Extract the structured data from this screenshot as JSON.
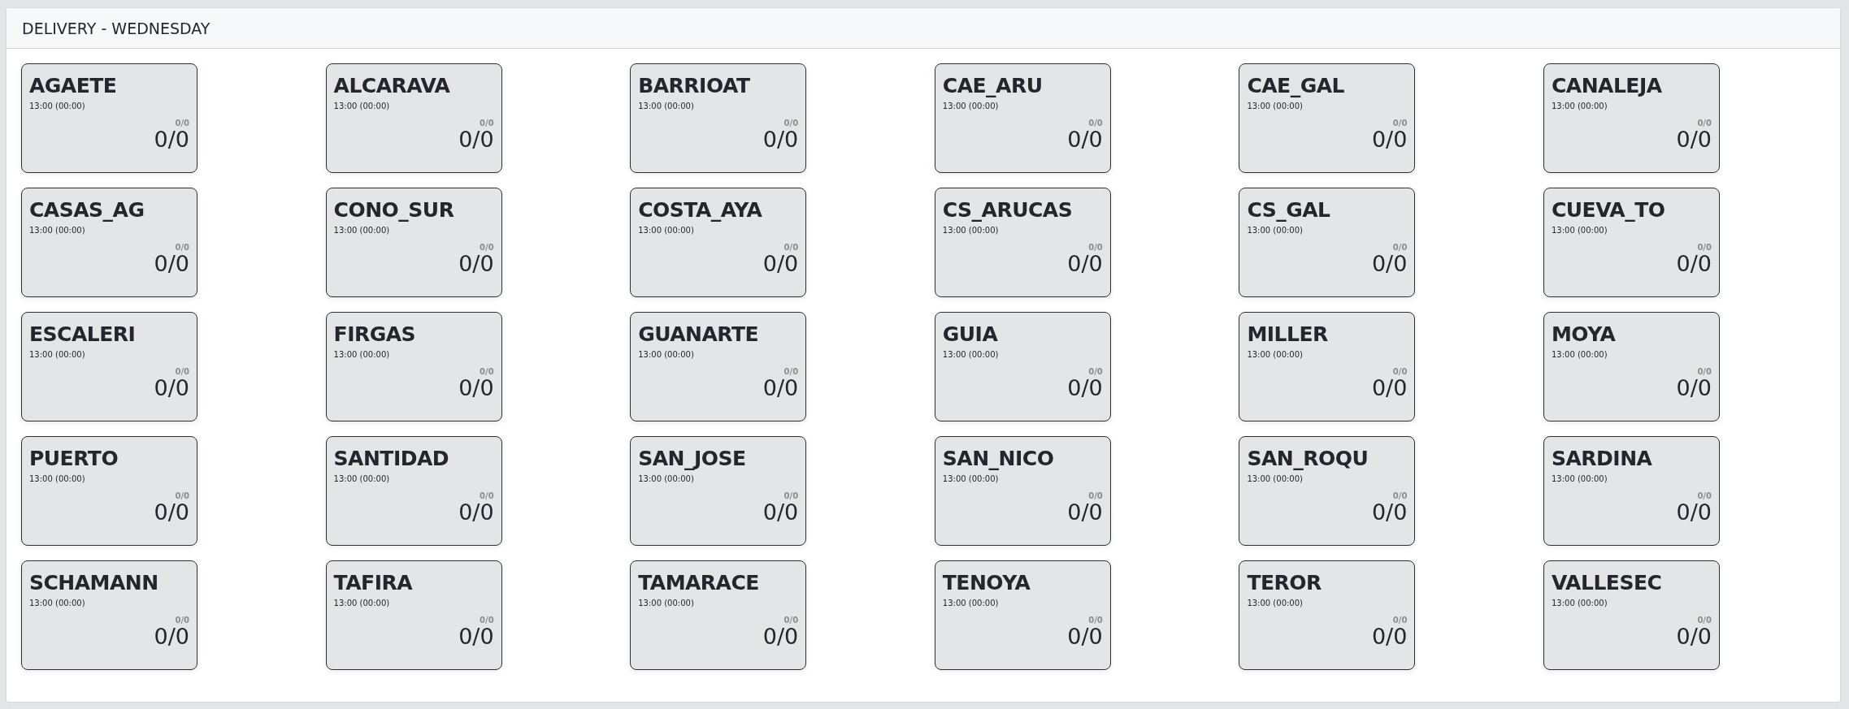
{
  "panel": {
    "title": "DELIVERY - WEDNESDAY"
  },
  "cards": [
    {
      "name": "AGAETE",
      "time": "13:00 (00:00)",
      "small_count": "0/0",
      "count": "0/0"
    },
    {
      "name": "ALCARAVA",
      "time": "13:00 (00:00)",
      "small_count": "0/0",
      "count": "0/0"
    },
    {
      "name": "BARRIOAT",
      "time": "13:00 (00:00)",
      "small_count": "0/0",
      "count": "0/0"
    },
    {
      "name": "CAE_ARU",
      "time": "13:00 (00:00)",
      "small_count": "0/0",
      "count": "0/0"
    },
    {
      "name": "CAE_GAL",
      "time": "13:00 (00:00)",
      "small_count": "0/0",
      "count": "0/0"
    },
    {
      "name": "CANALEJA",
      "time": "13:00 (00:00)",
      "small_count": "0/0",
      "count": "0/0"
    },
    {
      "name": "CASAS_AG",
      "time": "13:00 (00:00)",
      "small_count": "0/0",
      "count": "0/0"
    },
    {
      "name": "CONO_SUR",
      "time": "13:00 (00:00)",
      "small_count": "0/0",
      "count": "0/0"
    },
    {
      "name": "COSTA_AYA",
      "time": "13:00 (00:00)",
      "small_count": "0/0",
      "count": "0/0"
    },
    {
      "name": "CS_ARUCAS",
      "time": "13:00 (00:00)",
      "small_count": "0/0",
      "count": "0/0"
    },
    {
      "name": "CS_GAL",
      "time": "13:00 (00:00)",
      "small_count": "0/0",
      "count": "0/0"
    },
    {
      "name": "CUEVA_TO",
      "time": "13:00 (00:00)",
      "small_count": "0/0",
      "count": "0/0"
    },
    {
      "name": "ESCALERI",
      "time": "13:00 (00:00)",
      "small_count": "0/0",
      "count": "0/0"
    },
    {
      "name": "FIRGAS",
      "time": "13:00 (00:00)",
      "small_count": "0/0",
      "count": "0/0"
    },
    {
      "name": "GUANARTE",
      "time": "13:00 (00:00)",
      "small_count": "0/0",
      "count": "0/0"
    },
    {
      "name": "GUIA",
      "time": "13:00 (00:00)",
      "small_count": "0/0",
      "count": "0/0"
    },
    {
      "name": "MILLER",
      "time": "13:00 (00:00)",
      "small_count": "0/0",
      "count": "0/0"
    },
    {
      "name": "MOYA",
      "time": "13:00 (00:00)",
      "small_count": "0/0",
      "count": "0/0"
    },
    {
      "name": "PUERTO",
      "time": "13:00 (00:00)",
      "small_count": "0/0",
      "count": "0/0"
    },
    {
      "name": "SANTIDAD",
      "time": "13:00 (00:00)",
      "small_count": "0/0",
      "count": "0/0"
    },
    {
      "name": "SAN_JOSE",
      "time": "13:00 (00:00)",
      "small_count": "0/0",
      "count": "0/0"
    },
    {
      "name": "SAN_NICO",
      "time": "13:00 (00:00)",
      "small_count": "0/0",
      "count": "0/0"
    },
    {
      "name": "SAN_ROQU",
      "time": "13:00 (00:00)",
      "small_count": "0/0",
      "count": "0/0"
    },
    {
      "name": "SARDINA",
      "time": "13:00 (00:00)",
      "small_count": "0/0",
      "count": "0/0"
    },
    {
      "name": "SCHAMANN",
      "time": "13:00 (00:00)",
      "small_count": "0/0",
      "count": "0/0"
    },
    {
      "name": "TAFIRA",
      "time": "13:00 (00:00)",
      "small_count": "0/0",
      "count": "0/0"
    },
    {
      "name": "TAMARACE",
      "time": "13:00 (00:00)",
      "small_count": "0/0",
      "count": "0/0"
    },
    {
      "name": "TENOYA",
      "time": "13:00 (00:00)",
      "small_count": "0/0",
      "count": "0/0"
    },
    {
      "name": "TEROR",
      "time": "13:00 (00:00)",
      "small_count": "0/0",
      "count": "0/0"
    },
    {
      "name": "VALLESEC",
      "time": "13:00 (00:00)",
      "small_count": "0/0",
      "count": "0/0"
    }
  ]
}
